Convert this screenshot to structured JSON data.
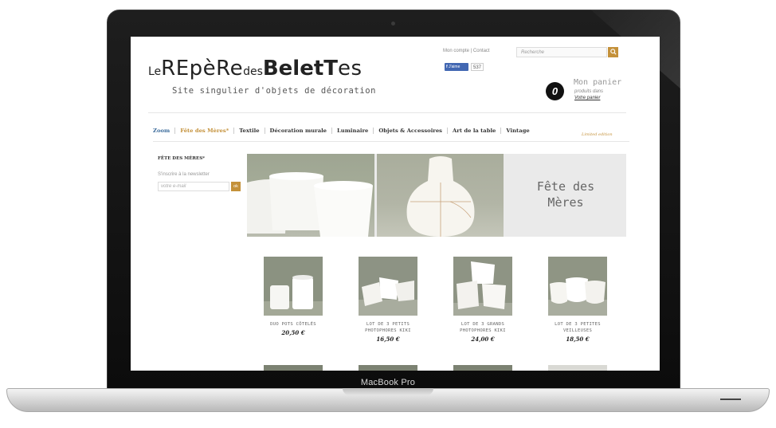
{
  "device": {
    "label": "MacBook Pro"
  },
  "site": {
    "top_links": {
      "account": "Mon compte",
      "separator": "|",
      "contact": "Contact"
    },
    "search": {
      "placeholder": "Recherche"
    },
    "facebook": {
      "like_label": "J'aime",
      "count": "537"
    },
    "logo": {
      "part1": "Le",
      "part2": "REpèRe",
      "part3": "des",
      "part4": "Bele",
      "part5": "tT",
      "part6": "es"
    },
    "tagline": "Site singulier d'objets de décoration",
    "cart": {
      "count": "0",
      "title": "Mon panier",
      "subtitle": "produits dans",
      "link": "Votre panier"
    },
    "nav": [
      {
        "label": "Zoom"
      },
      {
        "label": "Fête des Mères*"
      },
      {
        "label": "Textile"
      },
      {
        "label": "Décoration murale"
      },
      {
        "label": "Luminaire"
      },
      {
        "label": "Objets & Accessoires"
      },
      {
        "label": "Art de la table"
      },
      {
        "label": "Vintage"
      }
    ],
    "nav_vintage_sub": "Limited edition",
    "sidebar": {
      "title": "FÊTE DES MÈRES*",
      "newsletter_label": "S'inscrire à la newsletter",
      "email_placeholder": "votre e-mail",
      "ok_label": "ok"
    },
    "banner": {
      "line1": "Fête des",
      "line2": "Mères"
    },
    "products": [
      {
        "name1": "DUO POTS CÔTELÉS",
        "name2": "",
        "price": "20,50 €"
      },
      {
        "name1": "LOT DE 3 PETITS",
        "name2": "PHOTOPHORES KIKI",
        "price": "16,50 €"
      },
      {
        "name1": "LOT DE 3 GRANDS",
        "name2": "PHOTOPHORES KIKI",
        "price": "24,00 €"
      },
      {
        "name1": "LOT DE 3 PETITES",
        "name2": "VEILLEUSES",
        "price": "18,50 €"
      }
    ],
    "colors": {
      "accent": "#c4913a",
      "nav_highlight": "#3b6b9b",
      "facebook": "#4267b2"
    }
  }
}
